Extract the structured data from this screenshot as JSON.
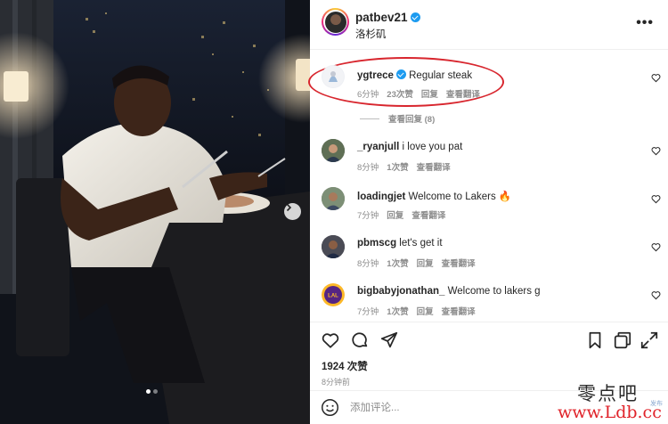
{
  "post": {
    "owner": "patbev21",
    "location": "洛杉矶",
    "more_label": "•••"
  },
  "comments": [
    {
      "user": "ygtrece",
      "text": "Regular steak",
      "time": "6分钟",
      "likes": "23次赞",
      "reply": "回复",
      "translate": "查看翻译",
      "verified": true
    },
    {
      "user": "_ryanjull",
      "text": "i love you pat",
      "time": "8分钟",
      "likes": "1次赞",
      "reply": "",
      "translate": "查看翻译"
    },
    {
      "user": "loadingjet",
      "text": "Welcome to Lakers 🔥",
      "time": "7分钟",
      "likes": "",
      "reply": "回复",
      "translate": "查看翻译"
    },
    {
      "user": "pbmscg",
      "text": "let's get it",
      "time": "8分钟",
      "likes": "1次赞",
      "reply": "回复",
      "translate": "查看翻译"
    },
    {
      "user": "bigbabyjonathan_",
      "text": "Welcome to lakers g",
      "time": "7分钟",
      "likes": "1次赞",
      "reply": "回复",
      "translate": "查看翻译"
    }
  ],
  "view_replies": "查看回复 (8)",
  "likes_total": "1924 次赞",
  "posted_ago": "8分钟前",
  "comment_placeholder": "添加评论...",
  "carousel": {
    "slides": 2,
    "active": 1
  },
  "icons": [
    "heart-icon",
    "comment-icon",
    "share-icon",
    "bookmark-icon",
    "copy-icon",
    "expand-icon",
    "emoji-icon",
    "chevron-right-icon",
    "verified-icon"
  ],
  "watermark": {
    "top": "零点吧",
    "bottom": "www.Ldb.cc",
    "small": "发布"
  },
  "colors": {
    "highlight": "#d8262e",
    "verified": "#1d9bf0",
    "muted": "#8e8e8e"
  }
}
